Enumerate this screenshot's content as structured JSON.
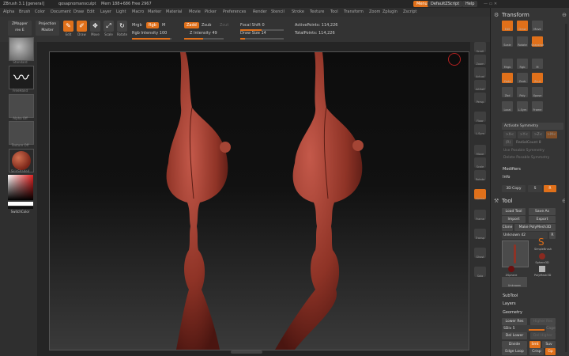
{
  "titlebar": {
    "app": "ZBrush 3.1 [general]",
    "doc": "qosapnomansculpt",
    "stats": "Mem 188+686  Free 2967",
    "menu_btn": "Menus",
    "script_btn": "DefaultZScript",
    "help_btn": "Help"
  },
  "menubar": [
    "Alpha",
    "Brush",
    "Color",
    "Document",
    "Draw",
    "Edit",
    "Layer",
    "Light",
    "Macro",
    "Marker",
    "Material",
    "Movie",
    "Picker",
    "Preferences",
    "Render",
    "Stencil",
    "Stroke",
    "Texture",
    "Tool",
    "Transform",
    "Zoom",
    "Zplugin",
    "Zscript"
  ],
  "toolbar": {
    "zmapper": "ZMapper",
    "zmapper_sub": "rev E",
    "projection": "Projection",
    "projection_sub": "Master",
    "edit": "Edit",
    "draw": "Draw",
    "move": "Move",
    "scale": "Scale",
    "rotate": "Rotate",
    "mrgb": "Mrgb",
    "rgb": "Rgb",
    "m": "M",
    "rgb_intensity": "Rgb Intensity 100",
    "zadd": "Zadd",
    "zsub": "Zsub",
    "zcut": "Zcut",
    "z_intensity": "Z Intensity 49",
    "focal_shift": "Focal Shift 0",
    "draw_size": "Draw Size 14",
    "active_points": "ActivePoints: 114,226",
    "total_points": "TotalPoints: 114,226"
  },
  "leftshelf": {
    "brush": "Standard",
    "stroke": "FreeHand",
    "alpha": "Alpha Off",
    "texture": "Texture Off",
    "material": "SkinShade4",
    "switch_color": "SwitchColor"
  },
  "rshelf": [
    "Scroll",
    "Zoom",
    "Actual",
    "AAHalf",
    "Persp",
    "Floor",
    "L.Sym",
    "Move",
    "Scale",
    "Rotate",
    "Xpose",
    "Frame",
    "Transp",
    "Ghost",
    "Solo"
  ],
  "rpanel": {
    "transform_title": "Transform",
    "transform_tiles": [
      "Edit",
      "Draw",
      "Move",
      "Scale",
      "Rotate",
      "Snapshot",
      "Mrgb",
      "Rgb",
      "M",
      "Zadd",
      "Zsub",
      "Zcut",
      "Zbd",
      "Poly",
      "Xpose",
      "Local",
      "L.Sym",
      "Frame"
    ],
    "activate_symmetry": "Activate Symmetry",
    "sym_x": ">X<",
    "sym_y": ">Y<",
    "sym_z": ">Z<",
    "sym_m": ">M<",
    "radial_count": "RadialCount 8",
    "sym_r": "(R)",
    "use_posable": "Use Posable Symmetry",
    "delete_posable": "Delete Posable Symmetry",
    "modifiers": "Modifiers",
    "info": "Info",
    "copy_3d": "3D Copy",
    "s_btn": "S",
    "r_btn": "R",
    "tool_title": "Tool",
    "load_tool": "Load Tool",
    "save_as": "Save As",
    "import": "Import",
    "export": "Export",
    "clone": "Clone",
    "make_polymesh": "Make PolyMesh3D",
    "current_tool": "Unknown 42",
    "tool_r": "R",
    "tools": [
      "SimpleBrush",
      "Sphere3D",
      "ZSphere",
      "PolyMesh3D",
      "Unknown"
    ],
    "subtool": "SubTool",
    "layers": "Layers",
    "geometry": "Geometry",
    "lower_res": "Lower Res",
    "higher_res": "Higher Res",
    "sdiv": "SDiv 5",
    "cage": "Cage",
    "del_lower": "Del Lower",
    "del_higher": "Del Higher",
    "divide": "Divide",
    "smt": "Smt",
    "suv": "Suv",
    "edge_loop": "Edge Loop",
    "crisp": "Crisp",
    "gp": "Gp"
  },
  "colors": {
    "accent": "#e0701a",
    "model": "#9a3a2c"
  }
}
